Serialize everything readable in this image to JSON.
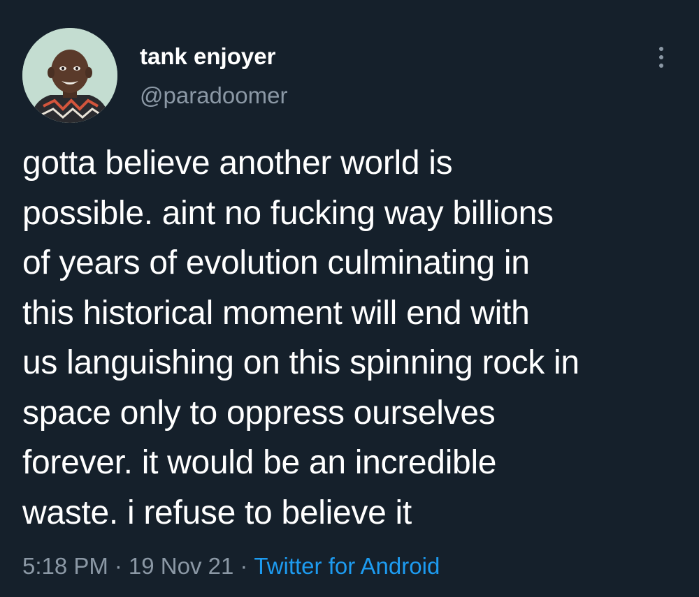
{
  "user": {
    "display_name": "tank enjoyer",
    "handle": "@paradoomer"
  },
  "more_icon": "more-vertical-icon",
  "tweet": {
    "text_lines": [
      "gotta believe another world is",
      "possible. aint no fucking way billions",
      "of years of evolution culminating in",
      "this historical moment will end with",
      "us languishing on this spinning rock in",
      "space only to oppress ourselves",
      "forever. it would be an incredible",
      "waste. i refuse to believe it"
    ],
    "time": "5:18 PM",
    "date": "19 Nov 21",
    "separator": "·",
    "source": "Twitter for Android"
  },
  "colors": {
    "background": "#15202b",
    "primary_text": "#ffffff",
    "secondary_text": "#8b98a5",
    "link": "#1d9bf0"
  }
}
